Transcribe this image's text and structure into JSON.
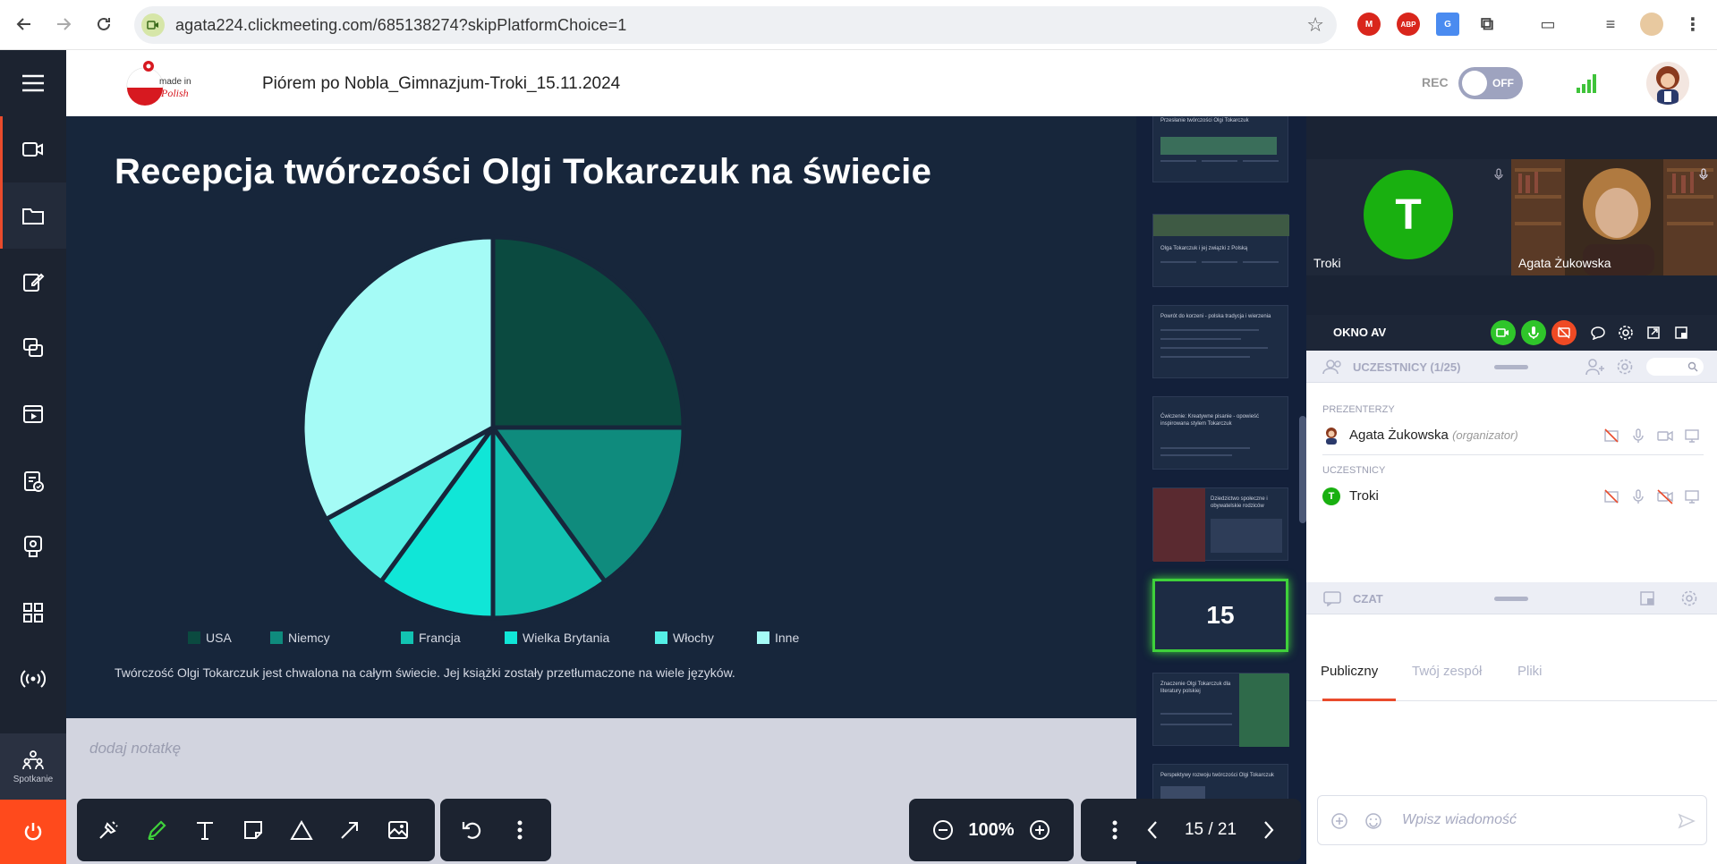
{
  "browser": {
    "url": "agata224.clickmeeting.com/685138274?skipPlatformChoice=1"
  },
  "header": {
    "logo_text": "made in Polish",
    "meeting_title": "Piórem po Nobla_Gimnazjum-Troki_15.11.2024",
    "rec_label": "REC",
    "rec_state": "OFF"
  },
  "sidebar": {
    "spotkanie_label": "Spotkanie"
  },
  "slide": {
    "title": "Recepcja twórczości Olgi Tokarczuk na świecie",
    "caption": "Twórczość Olgi Tokarczuk jest chwalona na całym świecie. Jej książki zostały przetłumaczone na wiele języków."
  },
  "chart_data": {
    "type": "pie",
    "categories": [
      "USA",
      "Niemcy",
      "Francja",
      "Wielka Brytania",
      "Włochy",
      "Inne"
    ],
    "values": [
      25,
      15,
      10,
      10,
      7,
      33
    ],
    "colors": [
      "#0b4a40",
      "#0f8b7d",
      "#12c3b2",
      "#10e6d7",
      "#54f0e6",
      "#a5fbf6"
    ],
    "legend": "bottom"
  },
  "notes": {
    "placeholder": "dodaj notatkę"
  },
  "thumbnails": [
    {
      "title": "Przesłanie twórczości Olgi Tokarczuk"
    },
    {
      "title": "Olga Tokarczuk i jej związki z Polską"
    },
    {
      "title": "Powrót do korzeni - polska tradycja i wierzenia"
    },
    {
      "title": "Ćwiczenie: Kreatywne pisanie - opowieść inspirowana stylem Tokarczuk"
    },
    {
      "title": "Dziedzictwo społeczne i obywatelskie rodziców"
    },
    {
      "title": "15"
    },
    {
      "title": "Znaczenie Olgi Tokarczuk dla literatury polskiej"
    },
    {
      "title": "Perspektywy rozwoju twórczości Olgi Tokarczuk"
    }
  ],
  "video": {
    "tiles": [
      {
        "name": "Troki",
        "initial": "T"
      },
      {
        "name": "Agata Żukowska"
      }
    ],
    "bar_label": "OKNO AV"
  },
  "participants": {
    "header": "UCZESTNICY (1/25)",
    "presenters_label": "PREZENTERZY",
    "attendees_label": "UCZESTNICY",
    "presenters": [
      {
        "name": "Agata Żukowska",
        "role": "(organizator)"
      }
    ],
    "attendees": [
      {
        "name": "Troki",
        "initial": "T"
      }
    ]
  },
  "chat": {
    "header": "CZAT",
    "tabs": [
      "Publiczny",
      "Twój zespół",
      "Pliki"
    ],
    "input_placeholder": "Wpisz wiadomość"
  },
  "toolbar": {
    "zoom": "100%",
    "page": "15 / 21"
  }
}
